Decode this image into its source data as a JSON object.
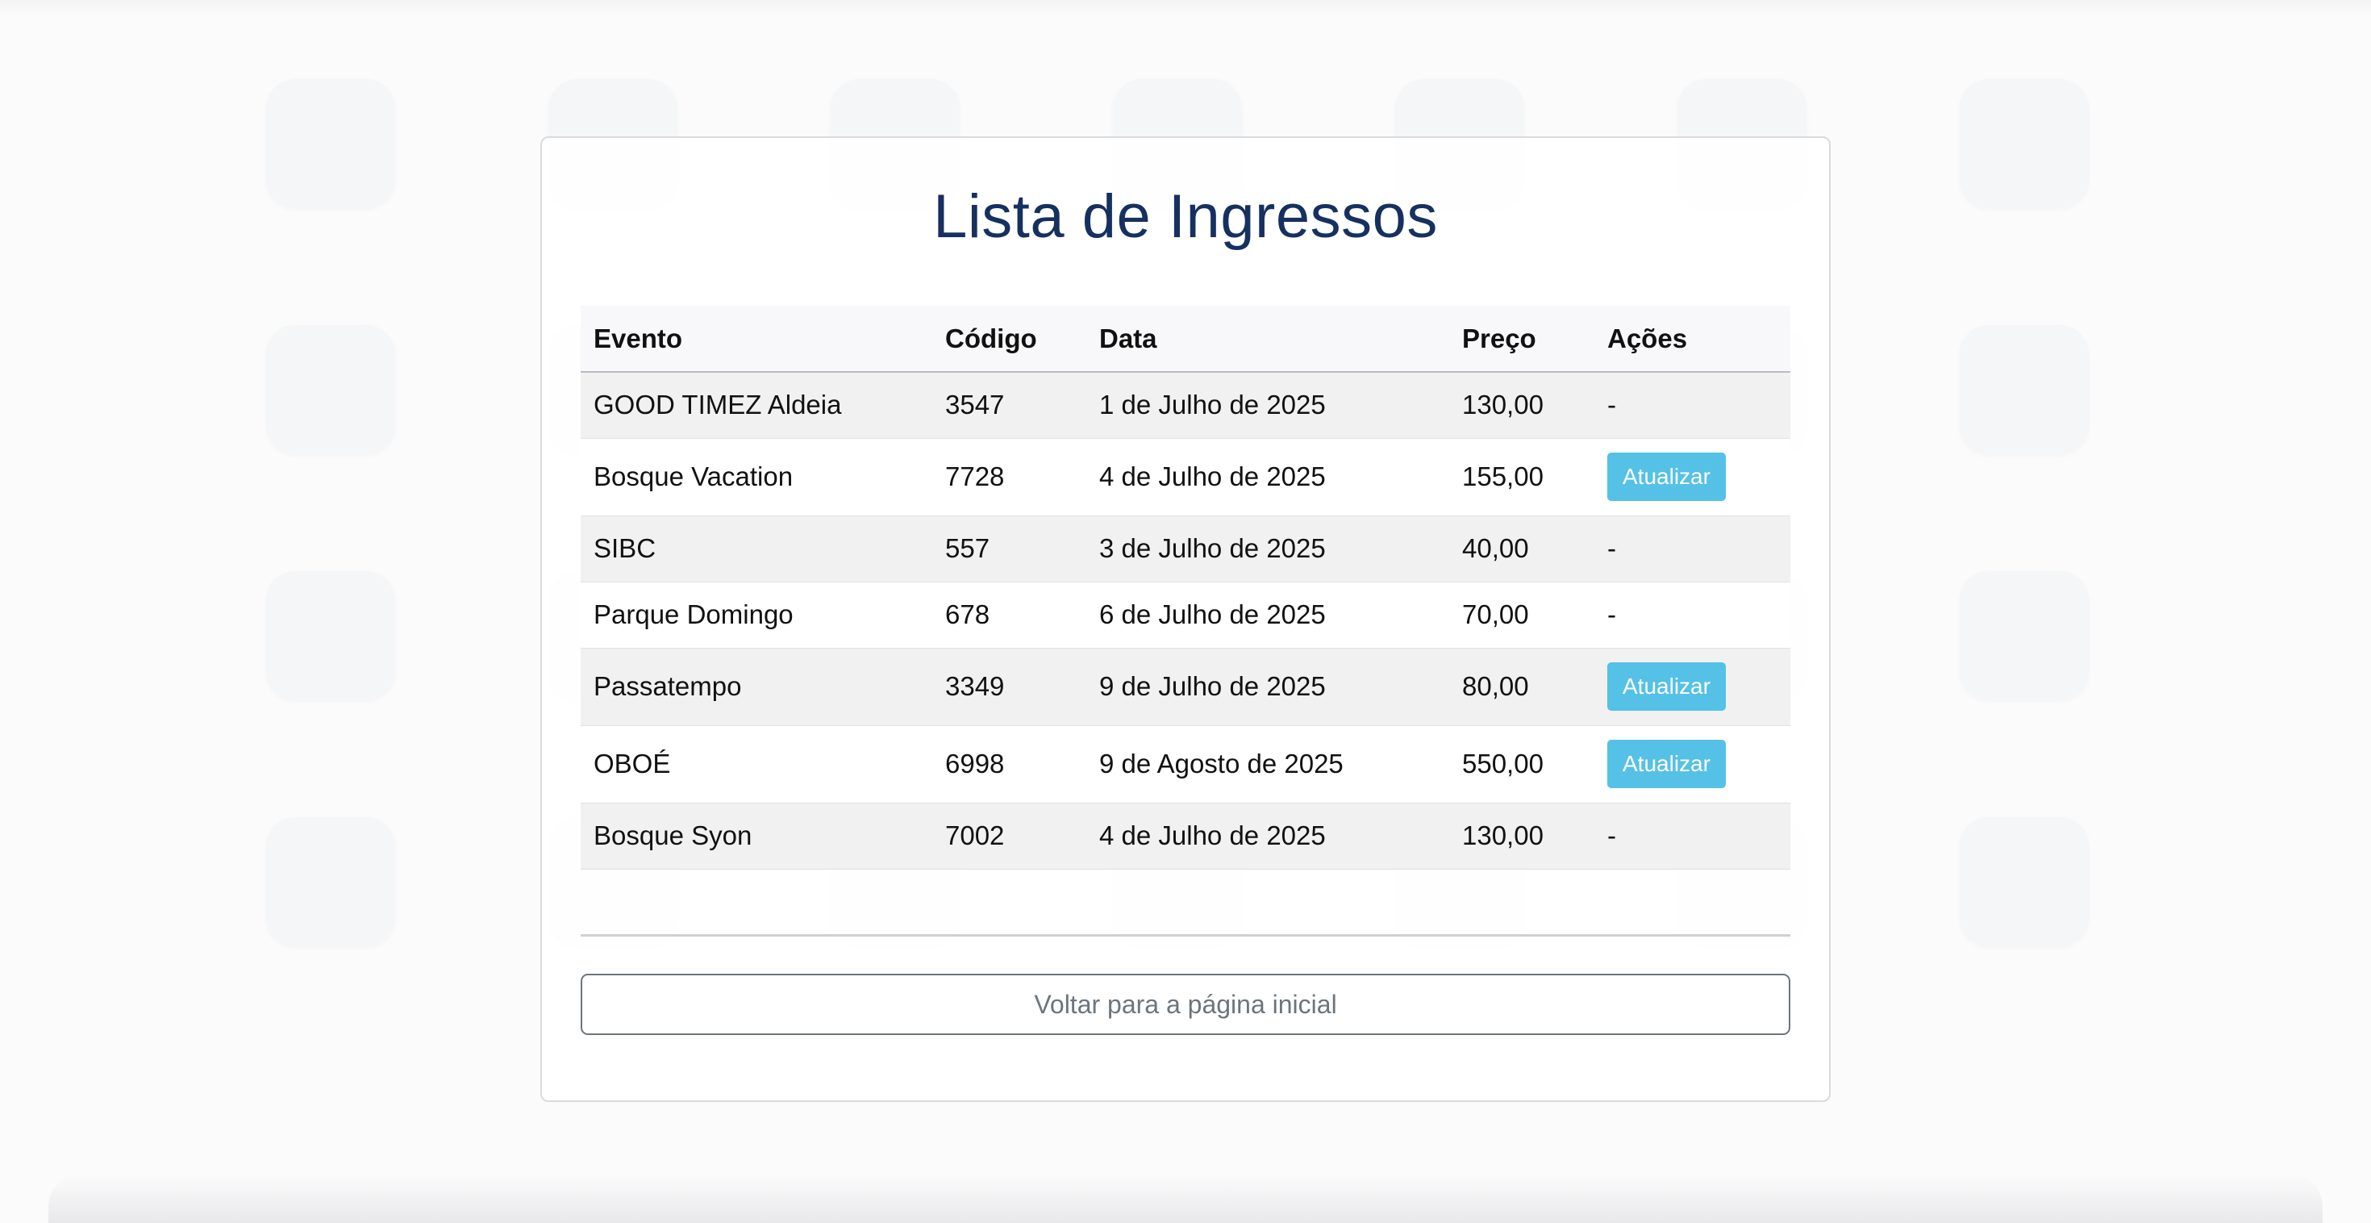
{
  "page": {
    "title": "Lista de Ingressos"
  },
  "table": {
    "headers": {
      "evento": "Evento",
      "codigo": "Código",
      "data": "Data",
      "preco": "Preço",
      "acoes": "Ações"
    },
    "rows": [
      {
        "evento": "GOOD TIMEZ Aldeia",
        "codigo": "3547",
        "data": "1 de Julho de 2025",
        "preco": "130,00",
        "acao": "-"
      },
      {
        "evento": "Bosque Vacation",
        "codigo": "7728",
        "data": "4 de Julho de 2025",
        "preco": "155,00",
        "acao": "Atualizar"
      },
      {
        "evento": "SIBC",
        "codigo": "557",
        "data": "3 de Julho de 2025",
        "preco": "40,00",
        "acao": "-"
      },
      {
        "evento": "Parque Domingo",
        "codigo": "678",
        "data": "6 de Julho de 2025",
        "preco": "70,00",
        "acao": "-"
      },
      {
        "evento": "Passatempo",
        "codigo": "3349",
        "data": "9 de Julho de 2025",
        "preco": "80,00",
        "acao": "Atualizar"
      },
      {
        "evento": "OBOÉ",
        "codigo": "6998",
        "data": "9 de Agosto de 2025",
        "preco": "550,00",
        "acao": "Atualizar"
      },
      {
        "evento": "Bosque Syon",
        "codigo": "7002",
        "data": "4 de Julho de 2025",
        "preco": "130,00",
        "acao": "-"
      }
    ]
  },
  "footer": {
    "home_button_label": "Voltar para a página inicial"
  },
  "colors": {
    "title": "#16305f",
    "update_button": "#55c1e6",
    "home_button_border": "#6c757d"
  }
}
